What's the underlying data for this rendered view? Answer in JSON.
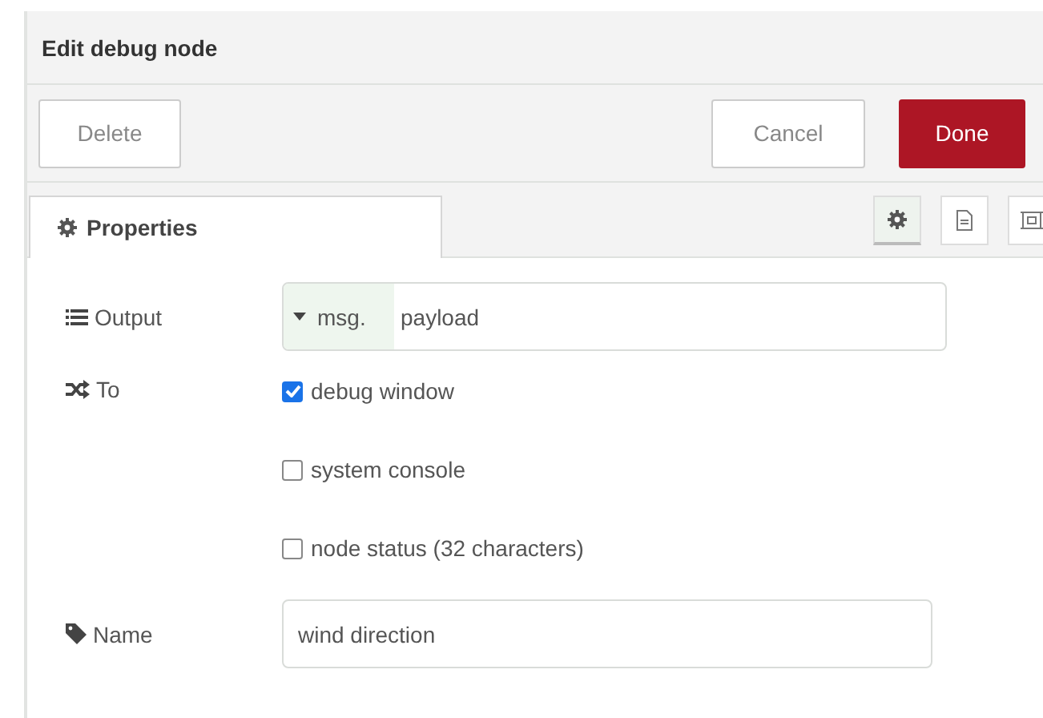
{
  "window": {
    "title": "Edit debug node"
  },
  "left_buttons": [
    {
      "label": "Delete"
    }
  ],
  "right_buttons": [
    {
      "label": "Cancel",
      "kind": "plain"
    },
    {
      "label": "Done",
      "kind": "primary"
    }
  ],
  "tabs": [
    {
      "label": "Properties",
      "selected": true
    }
  ],
  "side_tabs": [
    {
      "kind": "gear",
      "selected": true
    },
    {
      "kind": "document",
      "selected": false
    },
    {
      "kind": "frame",
      "selected": false
    }
  ],
  "output": {
    "label": "Output",
    "prefix": "msg.",
    "value": "payload"
  },
  "to": {
    "label": "To",
    "options": [
      {
        "label": "debug window",
        "checked": true
      },
      {
        "label": "system console",
        "checked": false
      },
      {
        "label": "node status (32 characters)",
        "checked": false
      }
    ]
  },
  "name": {
    "label": "Name",
    "value": "wind direction"
  }
}
